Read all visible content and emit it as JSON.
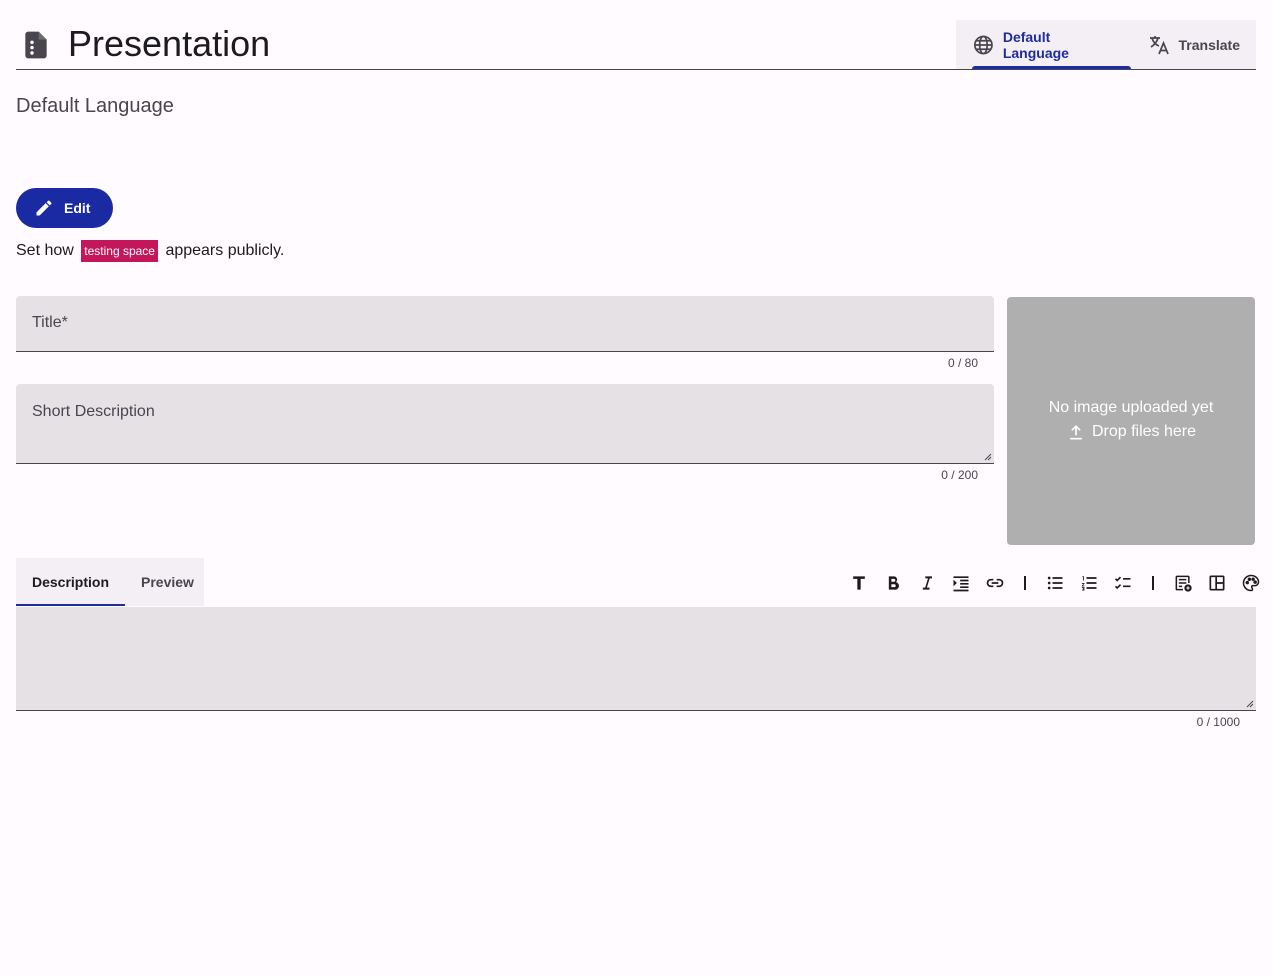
{
  "header": {
    "title": "Presentation",
    "icon": "document-icon",
    "tabs": [
      {
        "label": "Default Language",
        "icon": "globe-icon",
        "active": true
      },
      {
        "label": "Translate",
        "icon": "translate-icon",
        "active": false
      }
    ]
  },
  "section": {
    "title": "Default Language"
  },
  "edit_button": {
    "label": "Edit",
    "icon": "pencil-icon"
  },
  "hint": {
    "prefix": "Set how",
    "chip": "testing space",
    "suffix": "appears publicly."
  },
  "fields": {
    "title": {
      "label": "Title*",
      "value": "",
      "counter": "0 / 80"
    },
    "short_description": {
      "label": "Short Description",
      "value": "",
      "counter": "0 / 200"
    }
  },
  "image": {
    "empty_text": "No image uploaded yet",
    "drop_text": "Drop files here",
    "icon": "upload-icon"
  },
  "description": {
    "tabs": [
      {
        "label": "Description",
        "active": true
      },
      {
        "label": "Preview",
        "active": false
      }
    ],
    "toolbar": [
      "heading-icon",
      "bold-icon",
      "italic-icon",
      "indent-icon",
      "link-icon",
      "bullet-list-icon",
      "numbered-list-icon",
      "checklist-icon",
      "insert-card-icon",
      "table-icon",
      "palette-icon"
    ],
    "value": "",
    "counter": "0 / 1000"
  },
  "colors": {
    "accent": "#1a2aa3",
    "chip": "#c2185b",
    "field_bg": "#e6e1e5",
    "image_bg": "#b0afb0",
    "background": "#fffbfe"
  }
}
